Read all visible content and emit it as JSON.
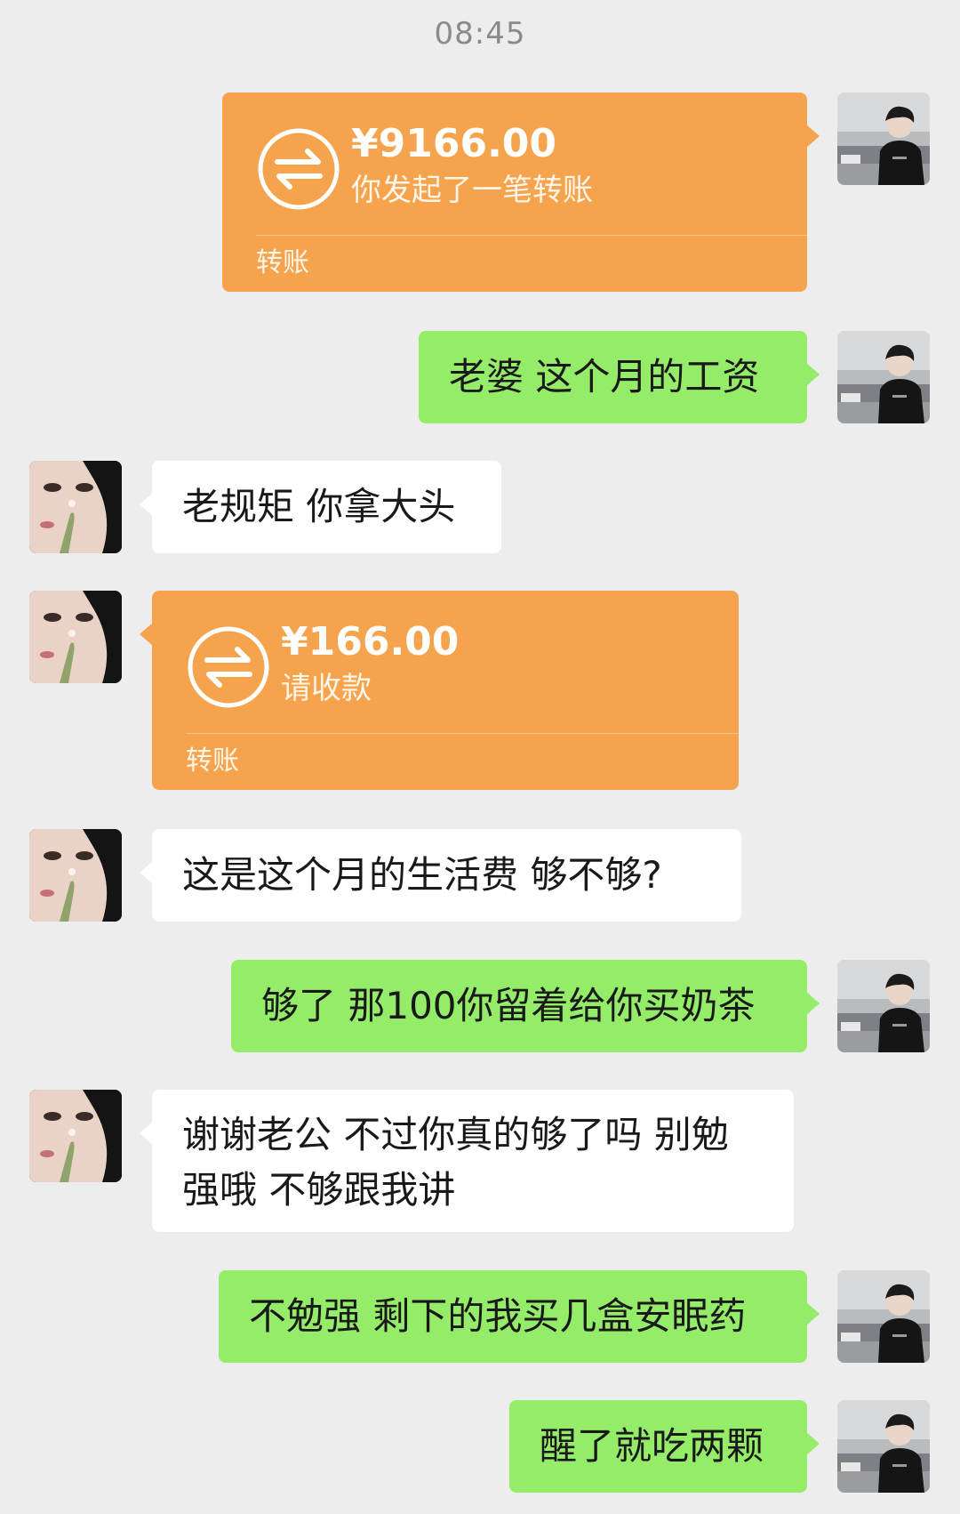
{
  "status_time": "08:45",
  "messages": [
    {
      "sender": "me",
      "type": "transfer",
      "amount": "¥9166.00",
      "desc": "你发起了一笔转账",
      "footer": "转账"
    },
    {
      "sender": "me",
      "type": "text",
      "text": "老婆 这个月的工资"
    },
    {
      "sender": "other",
      "type": "text",
      "text": "老规矩 你拿大头"
    },
    {
      "sender": "other",
      "type": "transfer",
      "amount": "¥166.00",
      "desc": "请收款",
      "footer": "转账"
    },
    {
      "sender": "other",
      "type": "text",
      "text": "这是这个月的生活费 够不够?"
    },
    {
      "sender": "me",
      "type": "text",
      "text": "够了 那100你留着给你买奶茶"
    },
    {
      "sender": "other",
      "type": "text",
      "lines": [
        "谢谢老公 不过你真的够了吗 别勉",
        "强哦 不够跟我讲"
      ]
    },
    {
      "sender": "me",
      "type": "text",
      "text": "不勉强 剩下的我买几盒安眠药"
    },
    {
      "sender": "me",
      "type": "text",
      "text": "醒了就吃两颗"
    }
  ],
  "colors": {
    "background": "#ededed",
    "my_bubble": "#95ec69",
    "their_bubble": "#ffffff",
    "transfer_card": "#f5a34d"
  }
}
